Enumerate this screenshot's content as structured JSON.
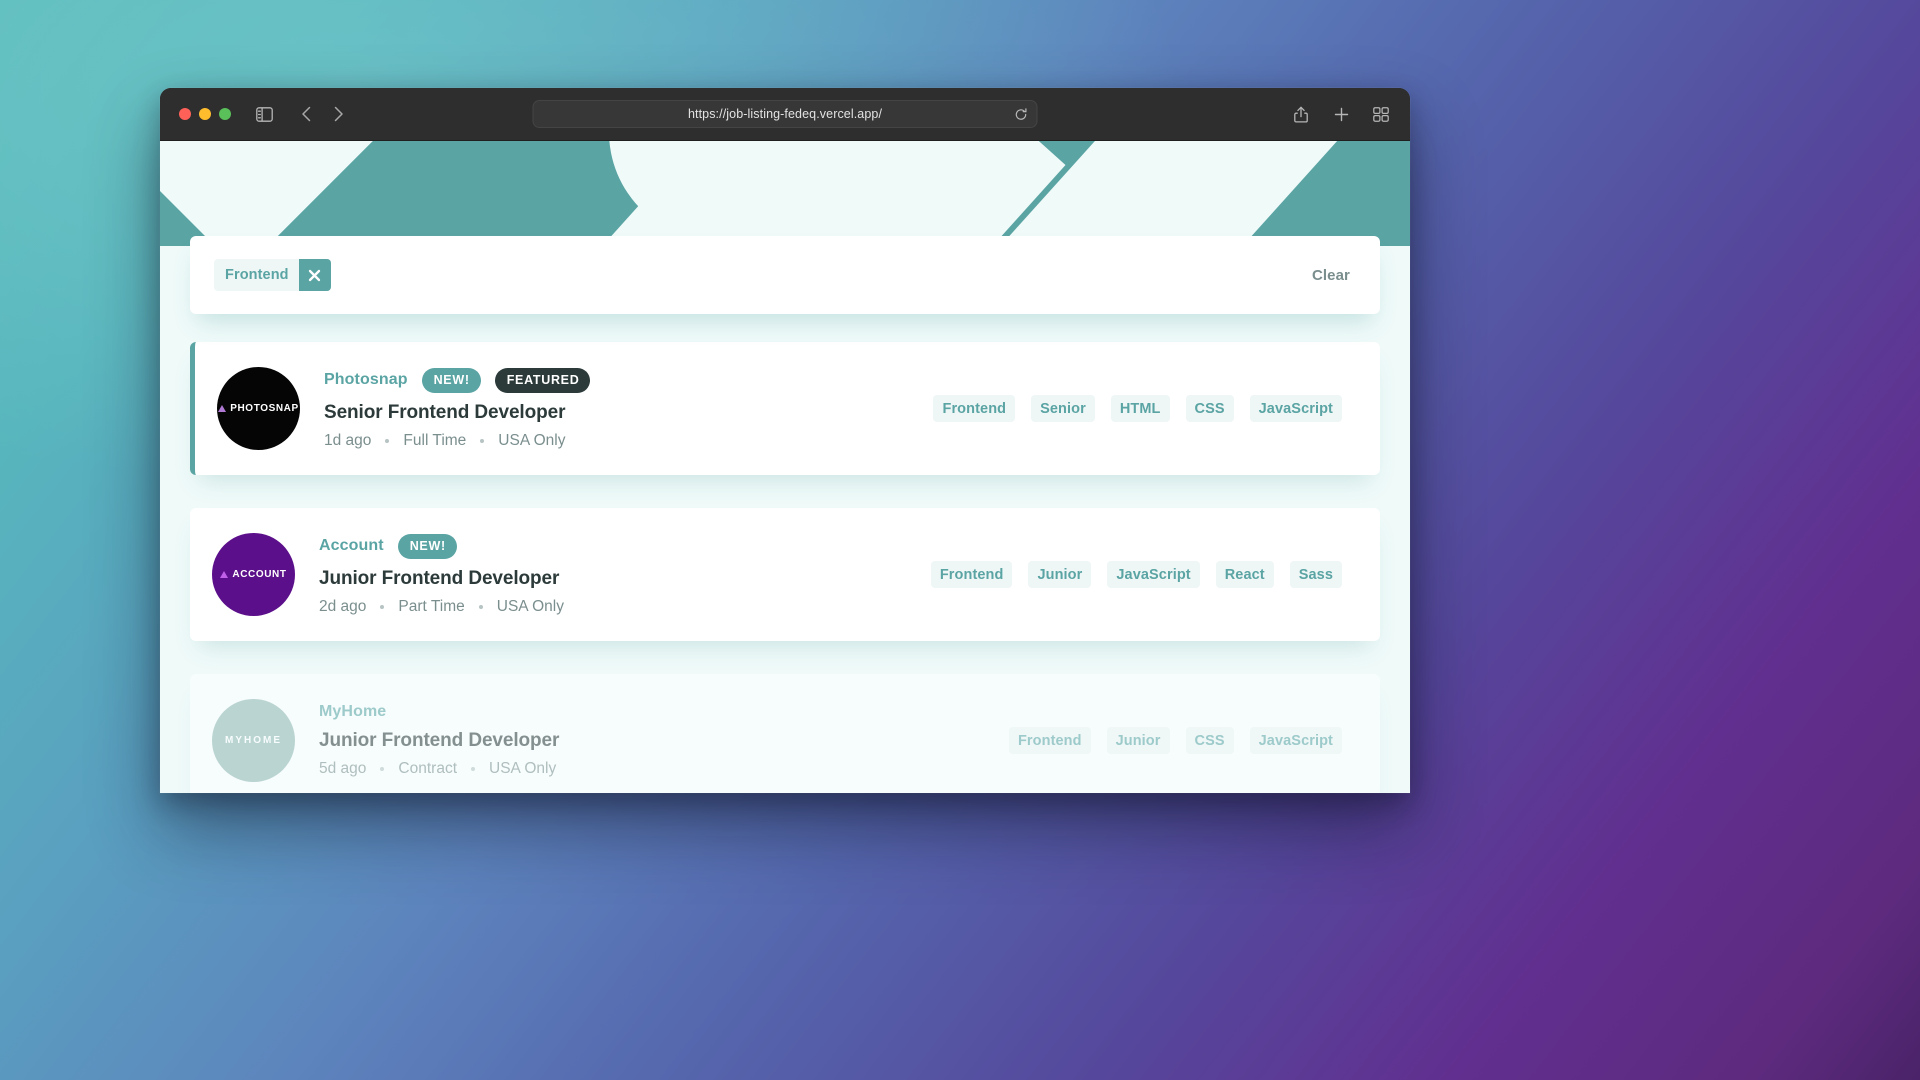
{
  "browser": {
    "url": "https://job-listing-fedeq.vercel.app/",
    "traffic_lights": [
      "close-button",
      "minimize-button",
      "maximize-button"
    ],
    "icons": {
      "sidebar": "sidebar-icon",
      "back": "back-chevron-icon",
      "forward": "forward-chevron-icon",
      "reload": "reload-icon",
      "share": "share-icon",
      "new_tab": "plus-icon",
      "tab_overview": "tab-overview-icon"
    }
  },
  "colors": {
    "accent_teal": "#5ba4a4",
    "page_bg": "#effaf9",
    "card_white": "#ffffff",
    "dark_text": "#2c3a3a",
    "muted_text": "#7b8e8e",
    "tag_bg": "#eff6f6"
  },
  "filter_bar": {
    "chips": [
      {
        "label": "Frontend",
        "remove_icon": "close-icon"
      }
    ],
    "clear_label": "Clear"
  },
  "jobs": [
    {
      "company": "Photosnap",
      "logo_text": "PHOTOSNAP",
      "logo_bg": "#050505",
      "logo_fg": "#ffffff",
      "logo_accent": "#b07ad4",
      "featured": true,
      "badges": [
        "NEW!",
        "FEATURED"
      ],
      "title": "Senior Frontend Developer",
      "posted": "1d ago",
      "contract": "Full Time",
      "location": "USA Only",
      "tags": [
        "Frontend",
        "Senior",
        "HTML",
        "CSS",
        "JavaScript"
      ]
    },
    {
      "company": "Account",
      "logo_text": "ACCOUNT",
      "logo_bg": "#5c0f8b",
      "logo_fg": "#ffffff",
      "logo_accent": "#c060e8",
      "featured": false,
      "badges": [
        "NEW!"
      ],
      "title": "Junior Frontend Developer",
      "posted": "2d ago",
      "contract": "Part Time",
      "location": "USA Only",
      "tags": [
        "Frontend",
        "Junior",
        "JavaScript",
        "React",
        "Sass"
      ]
    },
    {
      "company": "MyHome",
      "logo_text": "MYHOME",
      "logo_bg": "#8fb6b4",
      "logo_fg": "#ffffff",
      "logo_accent": "#ffffff",
      "featured": false,
      "badges": [],
      "title": "Junior Frontend Developer",
      "posted": "5d ago",
      "contract": "Contract",
      "location": "USA Only",
      "tags": [
        "Frontend",
        "Junior",
        "CSS",
        "JavaScript"
      ]
    }
  ]
}
